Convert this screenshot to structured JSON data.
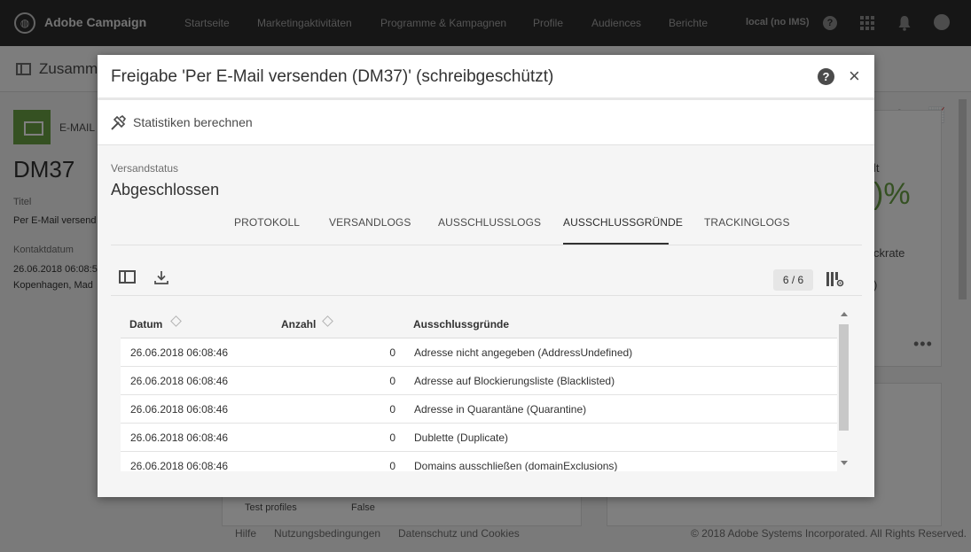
{
  "topbar": {
    "brand": "Adobe Campaign",
    "nav": [
      "Startseite",
      "Marketingaktivitäten",
      "Programme & Kampagnen",
      "Profile",
      "Audiences",
      "Berichte"
    ],
    "user": "local (no IMS)",
    "help": "?"
  },
  "background": {
    "subheader_title": "Zusamm",
    "email_label": "E-MAIL",
    "delivery_id": "DM37",
    "title_label": "Titel",
    "title_value": "Per E-Mail versend",
    "contact_label": "Kontaktdatum",
    "contact_date": "26.06.2018 06:08:5",
    "contact_tz": "Kopenhagen, Mad",
    "side_a": "lt",
    "percent": ")%",
    "side_b": "ckrate",
    "side_c": ")",
    "more": "•••",
    "test_profiles_label": "Test profiles",
    "test_profiles_value": "False",
    "footer": {
      "links": [
        "Hilfe",
        "Nutzungsbedingungen",
        "Datenschutz und Cookies"
      ],
      "copyright": "© 2018 Adobe Systems Incorporated. All Rights Reserved."
    }
  },
  "modal": {
    "title": "Freigabe 'Per E-Mail versenden (DM37)' (schreibgeschützt)",
    "help": "?",
    "close": "×",
    "calc_stats_label": "Statistiken berechnen",
    "status_label": "Versandstatus",
    "status_value": "Abgeschlossen",
    "tabs": [
      {
        "label": "PROTOKOLL"
      },
      {
        "label": "VERSANDLOGS"
      },
      {
        "label": "AUSSCHLUSSLOGS"
      },
      {
        "label": "AUSSCHLUSSGRÜNDE",
        "active": true
      },
      {
        "label": "TRACKINGLOGS"
      }
    ],
    "pagination": "6 / 6",
    "grid": {
      "columns": [
        "Datum",
        "Anzahl",
        "Ausschlussgründe"
      ],
      "rows": [
        {
          "date": "26.06.2018 06:08:46",
          "count": "0",
          "reason": "Adresse nicht angegeben (AddressUndefined)"
        },
        {
          "date": "26.06.2018 06:08:46",
          "count": "0",
          "reason": "Adresse auf Blockierungsliste (Blacklisted)"
        },
        {
          "date": "26.06.2018 06:08:46",
          "count": "0",
          "reason": "Adresse in Quarantäne (Quarantine)"
        },
        {
          "date": "26.06.2018 06:08:46",
          "count": "0",
          "reason": "Dublette (Duplicate)"
        },
        {
          "date": "26.06.2018 06:08:46",
          "count": "0",
          "reason": "Domains ausschließen (domainExclusions)"
        }
      ]
    }
  },
  "colors": {
    "topbar": "#2c2c2c",
    "accent_green": "#6aa345",
    "overlay": "rgba(0,0,0,0.5)"
  },
  "icons": [
    "adobe-logo-icon",
    "help-icon",
    "apps-grid-icon",
    "bell-icon",
    "avatar",
    "close-icon",
    "calculate-stats-icon",
    "list-view-icon",
    "download-icon",
    "column-config-icon",
    "sort-icon"
  ]
}
